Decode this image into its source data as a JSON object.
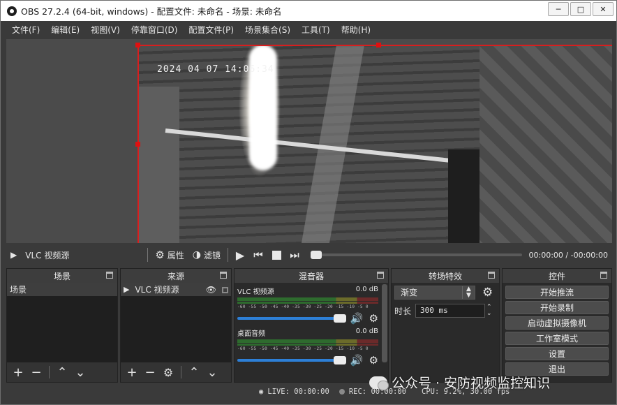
{
  "window": {
    "title": "OBS 27.2.4 (64-bit, windows) - 配置文件: 未命名 - 场景: 未命名",
    "minimize": "─",
    "maximize": "□",
    "close": "✕"
  },
  "menu": [
    "文件(F)",
    "编辑(E)",
    "视图(V)",
    "停靠窗口(D)",
    "配置文件(P)",
    "场景集合(S)",
    "工具(T)",
    "帮助(H)"
  ],
  "preview": {
    "timestamp": "2024 04 07 14:06:34"
  },
  "player": {
    "source_name": "VLC 视频源",
    "properties": "属性",
    "filters": "滤镜",
    "time": "00:00:00 / -00:00:00",
    "progress": 0
  },
  "docks": {
    "scenes": {
      "title": "场景",
      "items": [
        "场景"
      ]
    },
    "sources": {
      "title": "来源",
      "items": [
        "VLC 视频源"
      ]
    },
    "mixer": {
      "title": "混音器",
      "channels": [
        {
          "name": "VLC 视频源",
          "level": "0.0 dB",
          "volume": 1.0
        },
        {
          "name": "桌面音频",
          "level": "0.0 dB",
          "volume": 1.0
        }
      ],
      "scale": "-60 -55 -50 -45 -40 -35 -30 -25 -20 -15 -10 -5 0"
    },
    "transitions": {
      "title": "转场特效",
      "selected": "渐变",
      "duration_label": "时长",
      "duration_value": "300 ms"
    },
    "controls": {
      "title": "控件",
      "buttons": [
        "开始推流",
        "开始录制",
        "启动虚拟摄像机",
        "工作室模式",
        "设置",
        "退出"
      ]
    }
  },
  "status": {
    "live": "LIVE: 00:00:00",
    "rec": "REC: 00:00:00",
    "cpu": "CPU: 9.2%, 30.00 fps"
  },
  "watermark": "公众号 · 安防视频监控知识"
}
